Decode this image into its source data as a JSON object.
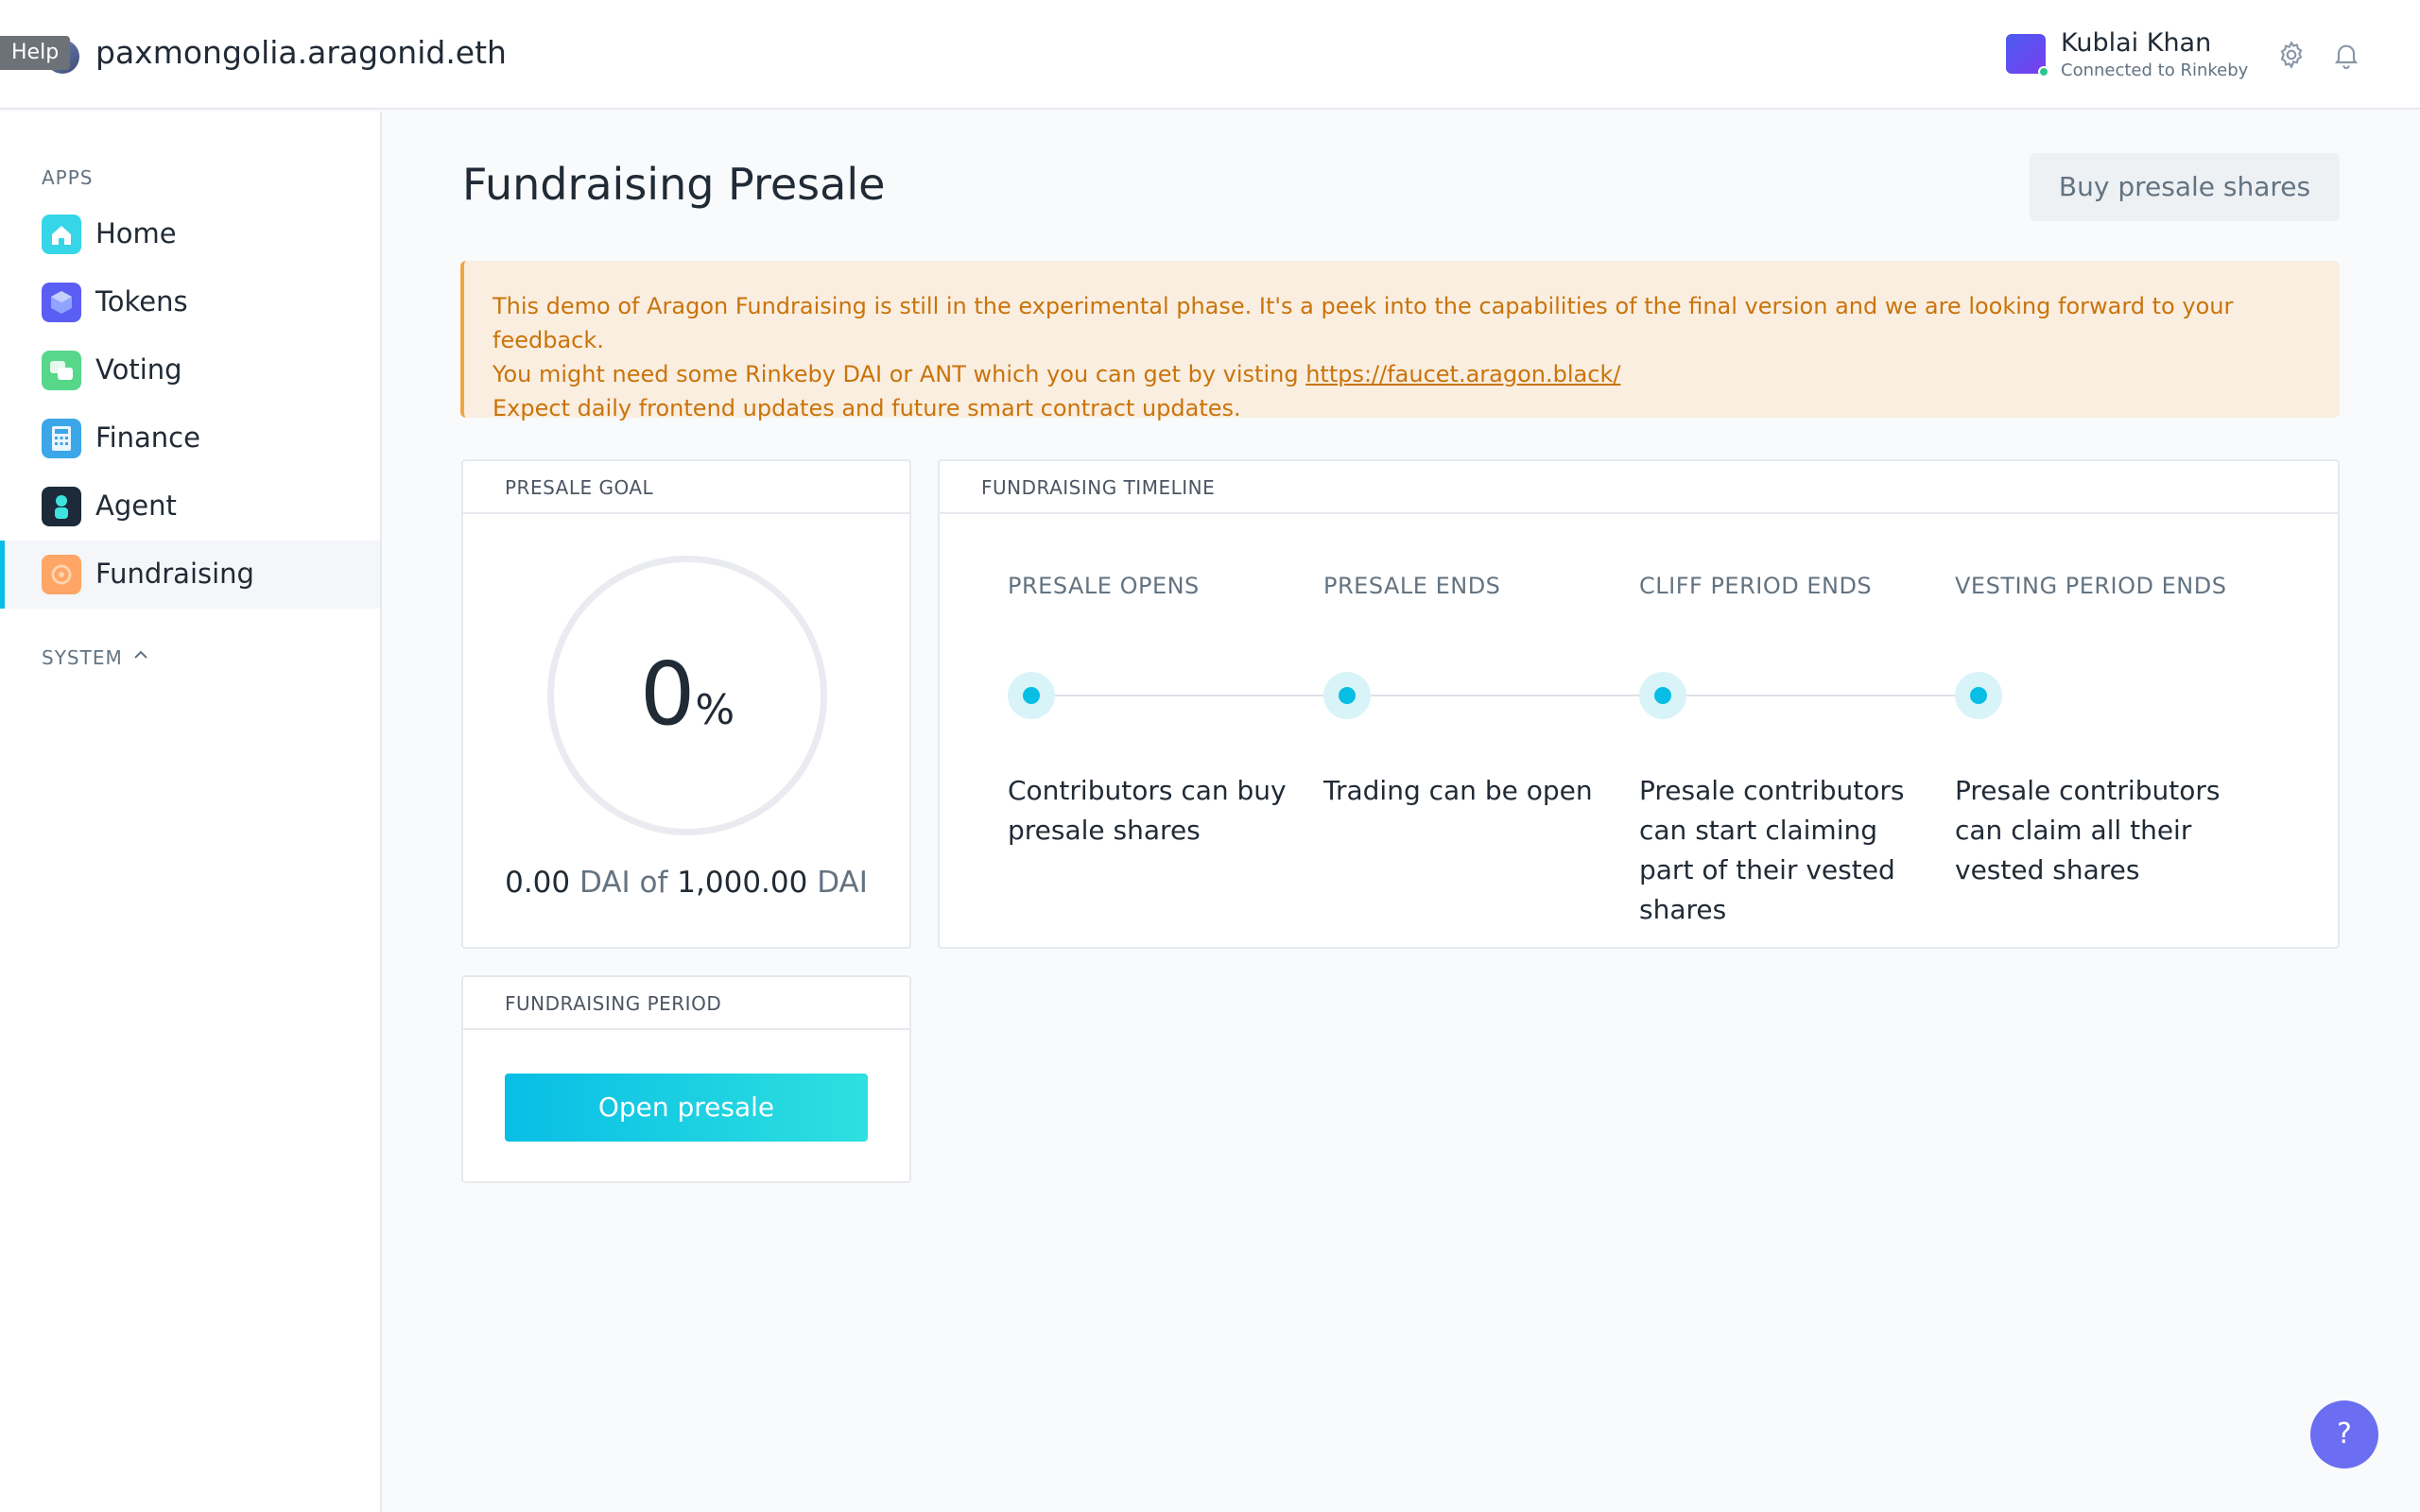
{
  "header": {
    "help_tag": "Help",
    "org_name": "paxmongolia.aragonid.eth",
    "user_name": "Kublai Khan",
    "user_status": "Connected to Rinkeby"
  },
  "sidebar": {
    "apps_title": "APPS",
    "items": [
      {
        "label": "Home",
        "icon": "home-icon",
        "color": "#36d6e8"
      },
      {
        "label": "Tokens",
        "icon": "tokens-icon",
        "color": "#5b5ef2"
      },
      {
        "label": "Voting",
        "icon": "voting-icon",
        "color": "#57d78a"
      },
      {
        "label": "Finance",
        "icon": "finance-icon",
        "color": "#3ba7e8"
      },
      {
        "label": "Agent",
        "icon": "agent-icon",
        "color": "#1c2a3a"
      },
      {
        "label": "Fundraising",
        "icon": "fundraising-icon",
        "color": "#ffa566"
      }
    ],
    "system_title": "SYSTEM"
  },
  "main": {
    "title": "Fundraising Presale",
    "buy_button": "Buy presale shares",
    "notice": {
      "line1": "This demo of Aragon Fundraising is still in the experimental phase. It's a peek into the capabilities of the final version and we are looking forward to your feedback.",
      "line2_prefix": "You might need some Rinkeby DAI or ANT which you can get by visting ",
      "line2_link": "https://faucet.aragon.black/",
      "line3": "Expect daily frontend updates and future smart contract updates."
    },
    "goal": {
      "title": "PRESALE GOAL",
      "percent": "0",
      "percent_symbol": "%",
      "raised": "0.00",
      "currency": "DAI",
      "of": "of",
      "target": "1,000.00"
    },
    "timeline": {
      "title": "FUNDRAISING TIMELINE",
      "steps": [
        {
          "label": "PRESALE OPENS",
          "desc": "Contributors can buy presale shares"
        },
        {
          "label": "PRESALE ENDS",
          "desc": "Trading can be open"
        },
        {
          "label": "CLIFF PERIOD ENDS",
          "desc": "Presale contributors can start claiming part of their vested shares"
        },
        {
          "label": "VESTING PERIOD ENDS",
          "desc": "Presale contributors can claim all their vested shares"
        }
      ]
    },
    "period": {
      "title": "FUNDRAISING PERIOD",
      "button": "Open presale"
    }
  },
  "help_fab": "?"
}
